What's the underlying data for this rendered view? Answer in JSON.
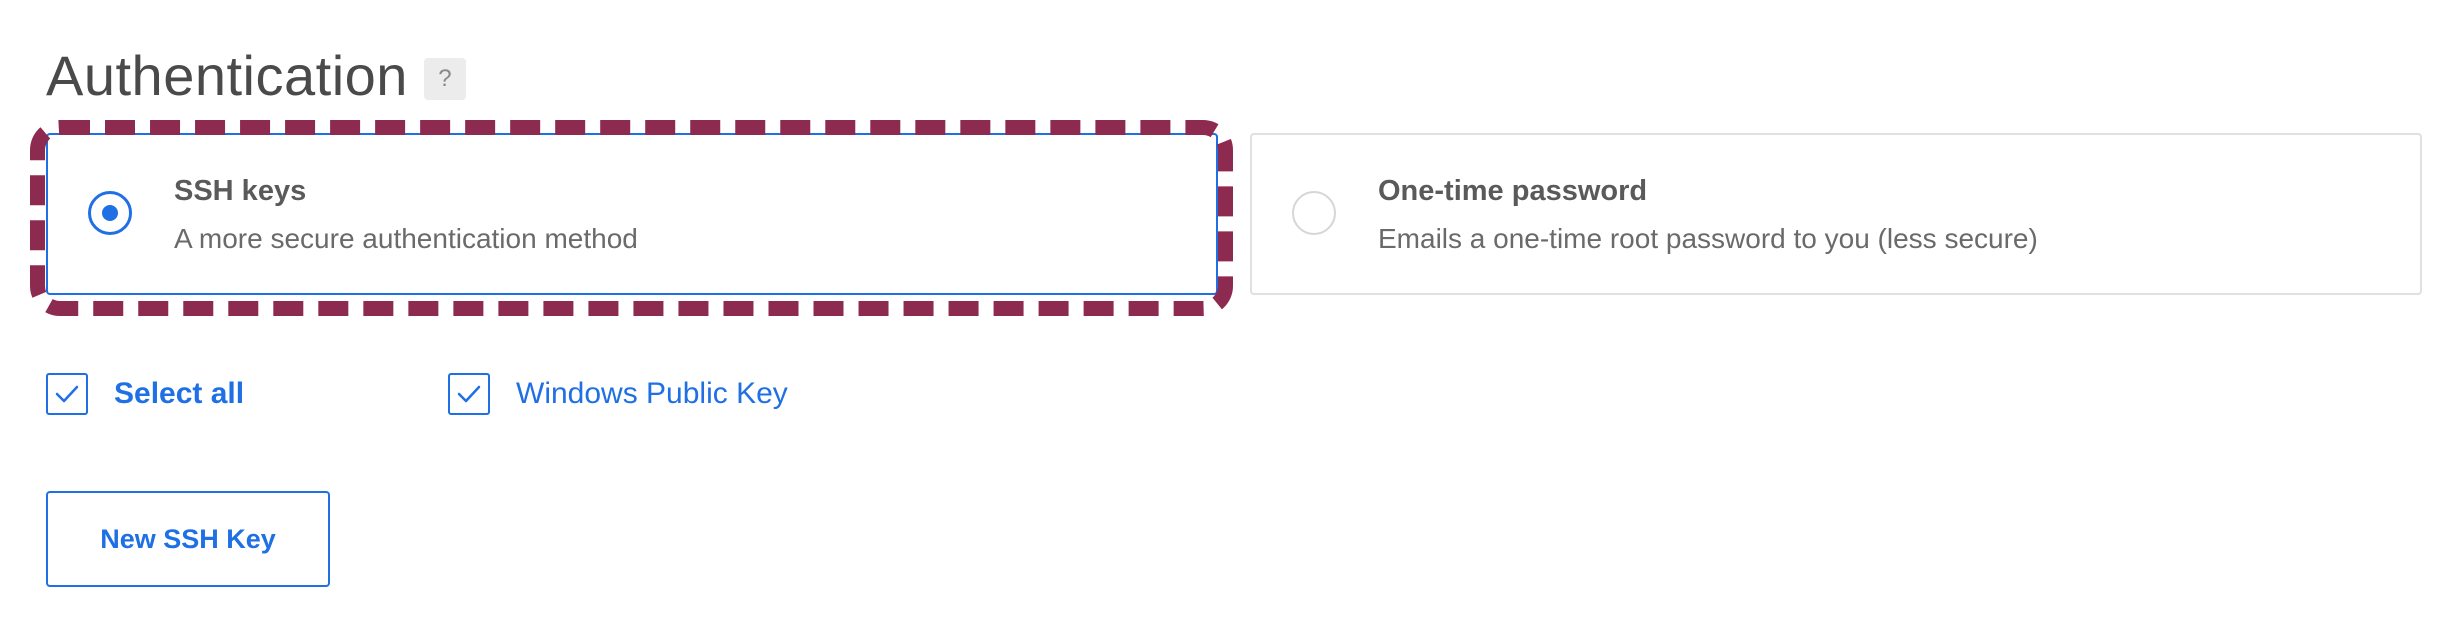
{
  "section": {
    "title": "Authentication",
    "help_icon": "?"
  },
  "options": [
    {
      "title": "SSH keys",
      "description": "A more secure authentication method",
      "selected": true
    },
    {
      "title": "One-time password",
      "description": "Emails a one-time root password to you (less secure)",
      "selected": false
    }
  ],
  "keys": {
    "select_all_label": "Select all",
    "select_all_checked": true,
    "items": [
      {
        "label": "Windows Public Key",
        "checked": true
      }
    ]
  },
  "actions": {
    "new_key_label": "New SSH Key"
  },
  "colors": {
    "accent": "#1f6fe5",
    "highlight": "#8d2a50",
    "muted_border": "#e0e0e0"
  },
  "icons": {
    "help": "question-mark-icon",
    "check": "checkmark-icon",
    "radio_selected": "radio-selected-icon",
    "radio_unselected": "radio-unselected-icon"
  }
}
